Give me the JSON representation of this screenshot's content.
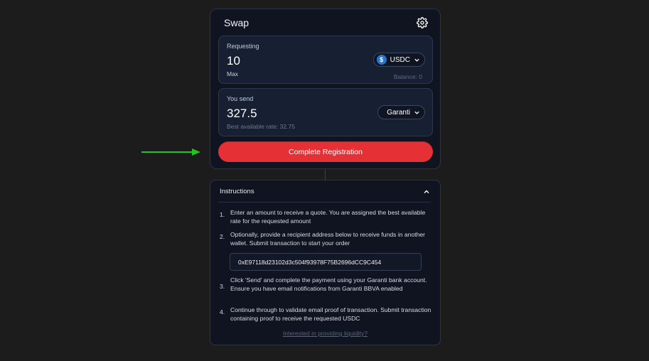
{
  "swap": {
    "title": "Swap",
    "requesting": {
      "label": "Requesting",
      "amount": "10",
      "max_label": "Max",
      "balance": "Balance: 0",
      "token": "USDC",
      "token_icon": "usdc-icon"
    },
    "send": {
      "label": "You send",
      "amount": "327.5",
      "rate": "Best available rate: 32.75",
      "token": "Garanti"
    },
    "cta_label": "Complete Registration"
  },
  "instructions": {
    "title": "Instructions",
    "steps": [
      {
        "num": "1.",
        "text": "Enter an amount to receive a quote. You are assigned the best available rate for the requested amount"
      },
      {
        "num": "2.",
        "text": "Optionally, provide a recipient address below to receive funds in another wallet. Submit transaction to start your order"
      },
      {
        "num": "3.",
        "text": "Click 'Send' and complete the payment using your Garanti bank account. Ensure you have email notifications from Garanti BBVA enabled"
      },
      {
        "num": "4.",
        "text": "Continue through to validate email proof of transaction. Submit transaction containing proof to receive the requested USDC"
      }
    ],
    "address": "0xE97118d23102d3c504f93978F75B2696dCC9C454",
    "liquidity_link": "Interested in providing liquidity?"
  },
  "colors": {
    "background": "#1c1c1c",
    "card": "#0f1420",
    "cta": "#e53035",
    "usdc": "#2775ca",
    "annotation_arrow": "#22c322"
  }
}
